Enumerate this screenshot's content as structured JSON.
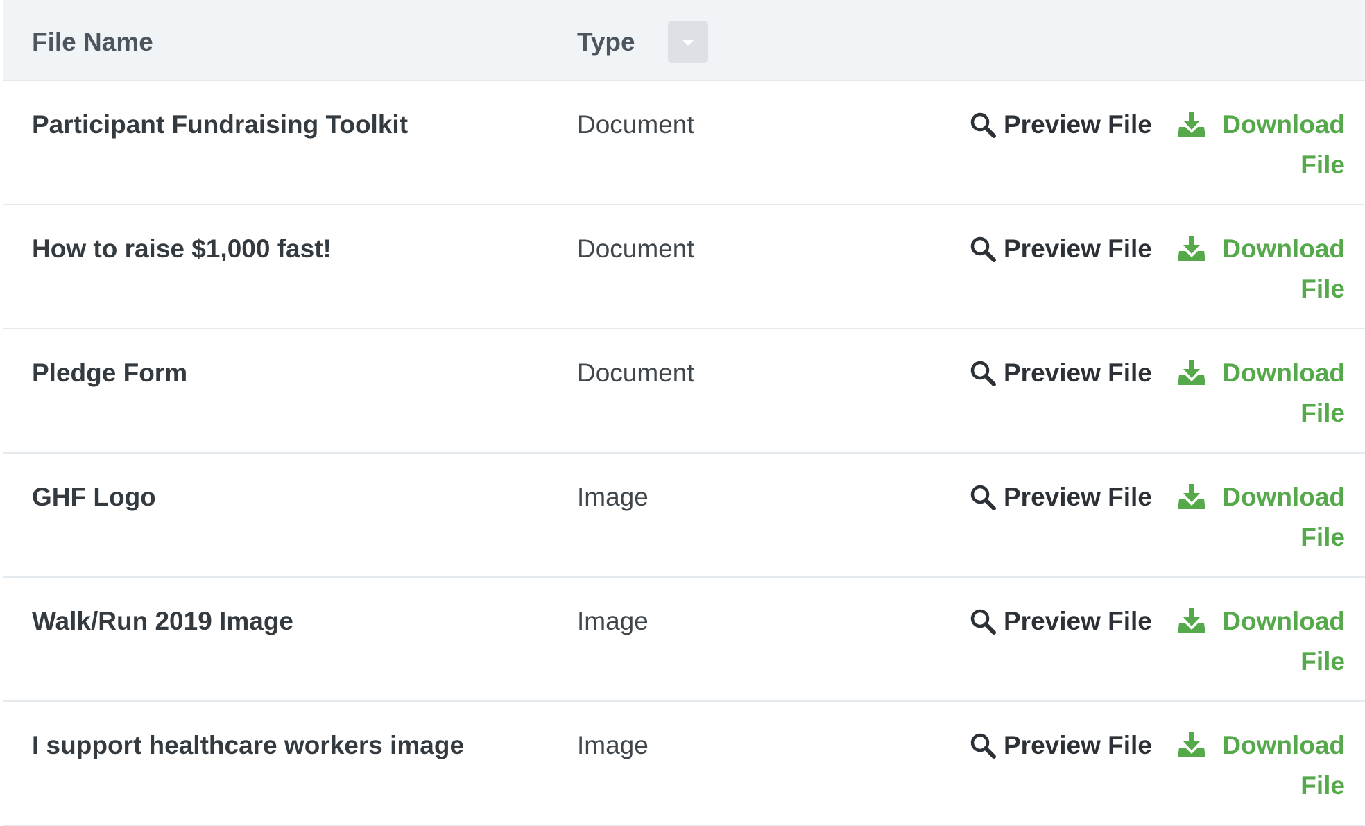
{
  "header": {
    "file_name_label": "File Name",
    "type_label": "Type",
    "type_filter_icon": "caret-down-icon"
  },
  "colors": {
    "header_bg": "#f1f4f7",
    "download_green": "#55a94a",
    "text_dark": "#333a40"
  },
  "rows": [
    {
      "name": "Participant Fundraising Toolkit",
      "type": "Document",
      "preview_label": "Preview File",
      "download_label": "Download File"
    },
    {
      "name": "How to raise $1,000 fast!",
      "type": "Document",
      "preview_label": "Preview File",
      "download_label": "Download File"
    },
    {
      "name": "Pledge Form",
      "type": "Document",
      "preview_label": "Preview File",
      "download_label": "Download File"
    },
    {
      "name": "GHF Logo",
      "type": "Image",
      "preview_label": "Preview File",
      "download_label": "Download File"
    },
    {
      "name": "Walk/Run 2019 Image",
      "type": "Image",
      "preview_label": "Preview File",
      "download_label": "Download File"
    },
    {
      "name": "I support healthcare workers image",
      "type": "Image",
      "preview_label": "Preview File",
      "download_label": "Download File"
    }
  ],
  "icons": {
    "preview": "magnifier-icon",
    "download": "download-tray-icon"
  }
}
